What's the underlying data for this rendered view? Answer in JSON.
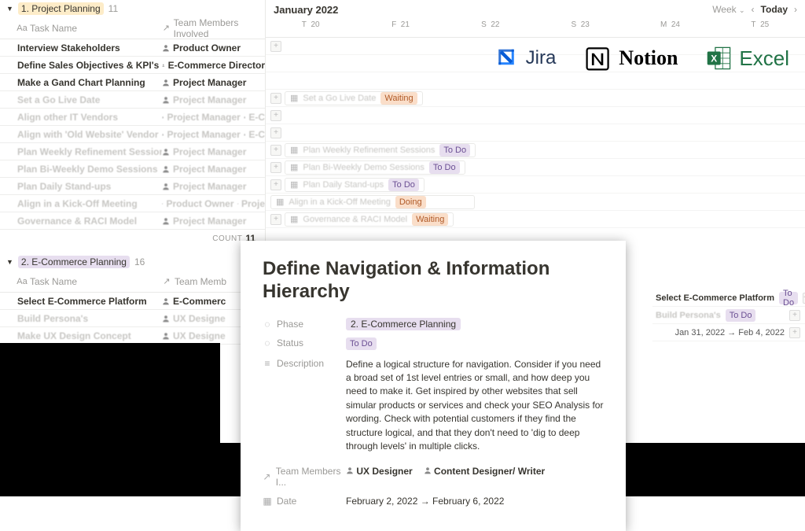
{
  "sections": [
    {
      "tag": "1. Project Planning",
      "count": 11,
      "columns": {
        "c1": "Task Name",
        "c2": "Team Members Involved"
      },
      "rows": [
        {
          "task": "Interview Stakeholders",
          "members": [
            "Product Owner"
          ],
          "faded": false
        },
        {
          "task": "Define Sales Objectives & KPI's",
          "members": [
            "E-Commerce Director"
          ],
          "faded": false
        },
        {
          "task": "Make a Gand Chart Planning",
          "members": [
            "Project Manager"
          ],
          "faded": false
        },
        {
          "task": "Set a Go Live Date",
          "members": [
            "Project Manager"
          ],
          "faded": true
        },
        {
          "task": "Align other IT Vendors",
          "members": [
            "Project Manager",
            "E-C"
          ],
          "faded": true
        },
        {
          "task": "Align with 'Old Website' Vendor",
          "members": [
            "Project Manager",
            "E-C"
          ],
          "faded": true
        },
        {
          "task": "Plan Weekly Refinement Sessions",
          "members": [
            "Project Manager"
          ],
          "faded": true
        },
        {
          "task": "Plan Bi-Weekly Demo Sessions",
          "members": [
            "Project Manager"
          ],
          "faded": true
        },
        {
          "task": "Plan Daily Stand-ups",
          "members": [
            "Project Manager"
          ],
          "faded": true
        },
        {
          "task": "Align in a Kick-Off Meeting",
          "members": [
            "Product Owner",
            "Proje"
          ],
          "faded": true
        },
        {
          "task": "Governance & RACI Model",
          "members": [
            "Project Manager"
          ],
          "faded": true
        }
      ],
      "countLabel": "COUNT",
      "countValue": "11"
    },
    {
      "tag": "2. E-Commerce Planning",
      "count": 16,
      "columns": {
        "c1": "Task Name",
        "c2": "Team Memb"
      },
      "rows": [
        {
          "task": "Select E-Commerce Platform",
          "members": [
            "E-Commerc"
          ],
          "faded": false
        },
        {
          "task": "Build Persona's",
          "members": [
            "UX Designe"
          ],
          "faded": true
        },
        {
          "task": "Make UX Design Concept",
          "members": [
            "UX Designe"
          ],
          "faded": true
        }
      ]
    }
  ],
  "calendar": {
    "title": "January 2022",
    "view": "Week",
    "today": "Today",
    "days": [
      {
        "label": "T",
        "num": "20"
      },
      {
        "label": "F",
        "num": "21"
      },
      {
        "label": "S",
        "num": "22"
      },
      {
        "label": "S",
        "num": "23"
      },
      {
        "label": "M",
        "num": "24"
      },
      {
        "label": "T",
        "num": "25"
      }
    ],
    "rows": [
      {
        "plus": true
      },
      {
        "plus": false
      },
      {
        "plus": false
      },
      {
        "plus": true,
        "event": {
          "text": "Set a Go Live Date",
          "status": "Waiting"
        }
      },
      {
        "plus": true
      },
      {
        "plus": true
      },
      {
        "plus": true,
        "event": {
          "text": "Plan Weekly Refinement Sessions",
          "status": "To Do"
        }
      },
      {
        "plus": true,
        "event": {
          "text": "Plan Bi-Weekly Demo Sessions",
          "status": "To Do"
        }
      },
      {
        "plus": true,
        "event": {
          "text": "Plan Daily Stand-ups",
          "status": "To Do"
        }
      },
      {
        "plus": false,
        "event": {
          "text": "Align in a Kick-Off Meeting",
          "status": "Doing"
        },
        "wide": true
      },
      {
        "plus": true,
        "event": {
          "text": "Governance & RACI Model",
          "status": "Waiting"
        }
      }
    ]
  },
  "rightSection2": [
    {
      "text": "Select E-Commerce Platform",
      "status": "To Do",
      "faded": false
    },
    {
      "text": "Build Persona's",
      "status": "To Do",
      "faded": true
    }
  ],
  "rightDates": "Jan 31, 2022 → Feb 4, 2022",
  "logos": {
    "jira": "Jira",
    "notion": "Notion",
    "excel": "Excel"
  },
  "detail": {
    "title": "Define Navigation & Information Hierarchy",
    "props": {
      "phaseLabel": "Phase",
      "phaseValue": "2. E-Commerce Planning",
      "statusLabel": "Status",
      "statusValue": "To Do",
      "descLabel": "Description",
      "descValue": "Define a logical structure for navigation. Consider if you need a broad set of 1st level entries or small, and how deep you need to make it. Get inspired by other websites that sell simular products or services and check your SEO Analysis for wording. Check with potential customers if they find the structure logical, and that they don't need to 'dig to deep through levels' in multiple clicks.",
      "teamLabel": "Team Members I...",
      "teamValue": [
        "UX Designer",
        "Content Designer/ Writer"
      ],
      "dateLabel": "Date",
      "dateValue": "February 2, 2022 → February 6, 2022"
    }
  }
}
